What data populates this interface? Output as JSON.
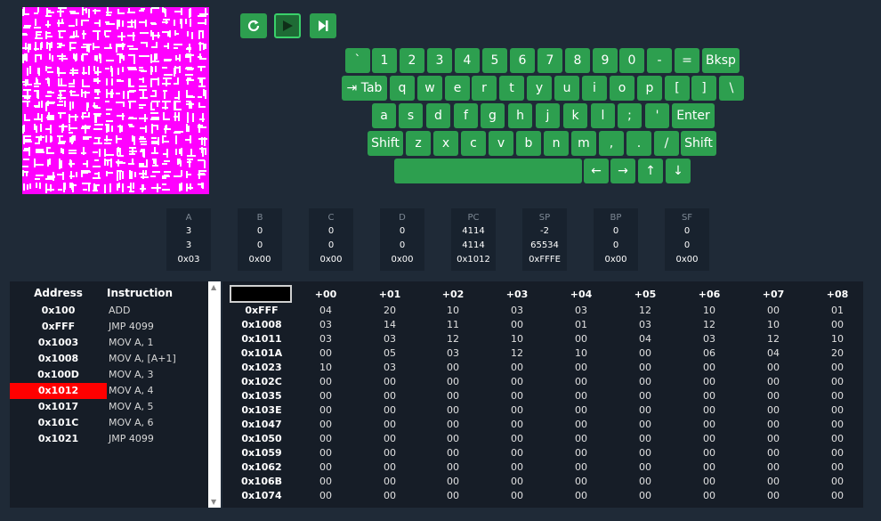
{
  "controls": {
    "reset": {
      "icon": "refresh-icon"
    },
    "run": {
      "icon": "play-icon"
    },
    "step": {
      "icon": "step-icon"
    }
  },
  "keyboard": {
    "rows": [
      [
        "`",
        "1",
        "2",
        "3",
        "4",
        "5",
        "6",
        "7",
        "8",
        "9",
        "0",
        "-",
        "=",
        "Bksp"
      ],
      [
        "⇥ Tab",
        "q",
        "w",
        "e",
        "r",
        "t",
        "y",
        "u",
        "i",
        "o",
        "p",
        "[",
        "]",
        "\\"
      ],
      [
        "a",
        "s",
        "d",
        "f",
        "g",
        "h",
        "j",
        "k",
        "l",
        ";",
        "'",
        "Enter"
      ],
      [
        "Shift",
        "z",
        "x",
        "c",
        "v",
        "b",
        "n",
        "m",
        ",",
        ".",
        "/",
        "Shift"
      ],
      [
        "",
        "←",
        "→",
        "↑",
        "↓"
      ]
    ]
  },
  "registers": [
    {
      "name": "A",
      "dec": "3",
      "udec": "3",
      "hex": "0x03"
    },
    {
      "name": "B",
      "dec": "0",
      "udec": "0",
      "hex": "0x00"
    },
    {
      "name": "C",
      "dec": "0",
      "udec": "0",
      "hex": "0x00"
    },
    {
      "name": "D",
      "dec": "0",
      "udec": "0",
      "hex": "0x00"
    },
    {
      "name": "PC",
      "dec": "4114",
      "udec": "4114",
      "hex": "0x1012"
    },
    {
      "name": "SP",
      "dec": "-2",
      "udec": "65534",
      "hex": "0xFFFE"
    },
    {
      "name": "BP",
      "dec": "0",
      "udec": "0",
      "hex": "0x00"
    },
    {
      "name": "SF",
      "dec": "0",
      "udec": "0",
      "hex": "0x00"
    }
  ],
  "code": {
    "header_address": "Address",
    "header_instruction": "Instruction",
    "highlight_index": 6,
    "rows": [
      {
        "addr": "0x100",
        "ins": "ADD"
      },
      {
        "addr": "0xFFF",
        "ins": "JMP 4099"
      },
      {
        "addr": "0x1003",
        "ins": "MOV A, 1"
      },
      {
        "addr": "0x1008",
        "ins": "MOV A, [A+1]"
      },
      {
        "addr": "0x100D",
        "ins": "MOV A, 3"
      },
      {
        "addr": "0x1012",
        "ins": "MOV A, 4"
      },
      {
        "addr": "0x1017",
        "ins": "MOV A, 5"
      },
      {
        "addr": "0x101C",
        "ins": "MOV A, 6"
      },
      {
        "addr": "0x1021",
        "ins": "JMP 4099"
      }
    ]
  },
  "memory": {
    "input_value": "",
    "columns": [
      "+00",
      "+01",
      "+02",
      "+03",
      "+04",
      "+05",
      "+06",
      "+07",
      "+08"
    ],
    "rows": [
      {
        "addr": "0xFFF",
        "cells": [
          "04",
          "20",
          "10",
          "03",
          "03",
          "12",
          "10",
          "00",
          "01"
        ]
      },
      {
        "addr": "0x1008",
        "cells": [
          "03",
          "14",
          "11",
          "00",
          "01",
          "03",
          "12",
          "10",
          "00"
        ]
      },
      {
        "addr": "0x1011",
        "cells": [
          "03",
          "03",
          "12",
          "10",
          "00",
          "04",
          "03",
          "12",
          "10"
        ]
      },
      {
        "addr": "0x101A",
        "cells": [
          "00",
          "05",
          "03",
          "12",
          "10",
          "00",
          "06",
          "04",
          "20"
        ]
      },
      {
        "addr": "0x1023",
        "cells": [
          "10",
          "03",
          "00",
          "00",
          "00",
          "00",
          "00",
          "00",
          "00"
        ]
      },
      {
        "addr": "0x102C",
        "cells": [
          "00",
          "00",
          "00",
          "00",
          "00",
          "00",
          "00",
          "00",
          "00"
        ]
      },
      {
        "addr": "0x1035",
        "cells": [
          "00",
          "00",
          "00",
          "00",
          "00",
          "00",
          "00",
          "00",
          "00"
        ]
      },
      {
        "addr": "0x103E",
        "cells": [
          "00",
          "00",
          "00",
          "00",
          "00",
          "00",
          "00",
          "00",
          "00"
        ]
      },
      {
        "addr": "0x1047",
        "cells": [
          "00",
          "00",
          "00",
          "00",
          "00",
          "00",
          "00",
          "00",
          "00"
        ]
      },
      {
        "addr": "0x1050",
        "cells": [
          "00",
          "00",
          "00",
          "00",
          "00",
          "00",
          "00",
          "00",
          "00"
        ]
      },
      {
        "addr": "0x1059",
        "cells": [
          "00",
          "00",
          "00",
          "00",
          "00",
          "00",
          "00",
          "00",
          "00"
        ]
      },
      {
        "addr": "0x1062",
        "cells": [
          "00",
          "00",
          "00",
          "00",
          "00",
          "00",
          "00",
          "00",
          "00"
        ]
      },
      {
        "addr": "0x106B",
        "cells": [
          "00",
          "00",
          "00",
          "00",
          "00",
          "00",
          "00",
          "00",
          "00"
        ]
      },
      {
        "addr": "0x1074",
        "cells": [
          "00",
          "00",
          "00",
          "00",
          "00",
          "00",
          "00",
          "00",
          "00"
        ]
      }
    ]
  },
  "colors": {
    "background": "#1f2a37",
    "key_green": "#2d9f4f",
    "highlight_red": "#ff0000",
    "charset_bg": "#ff00ff"
  }
}
